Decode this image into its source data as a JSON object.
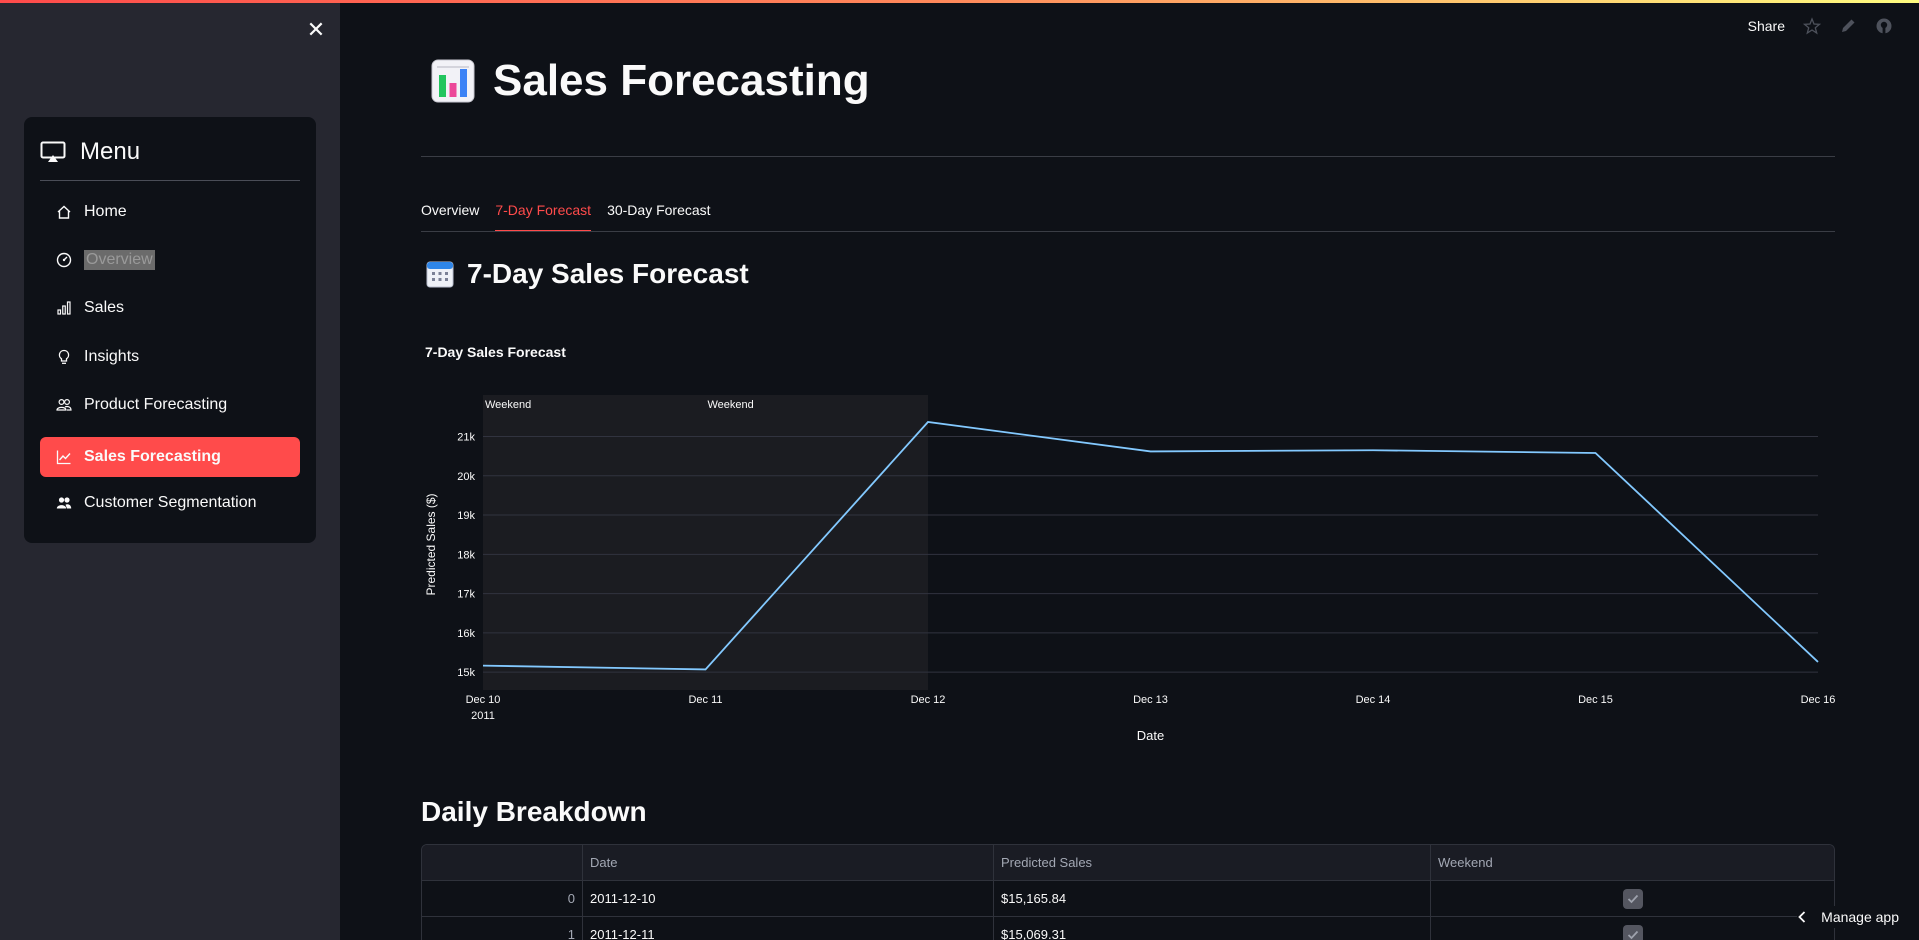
{
  "sidebar": {
    "menu_title": "Menu",
    "items": [
      {
        "label": "Home",
        "icon": "house-icon"
      },
      {
        "label": "Overview",
        "icon": "speedometer-icon"
      },
      {
        "label": "Sales",
        "icon": "bar-chart-icon"
      },
      {
        "label": "Insights",
        "icon": "lightbulb-icon"
      },
      {
        "label": "Product Forecasting",
        "icon": "people-icon"
      },
      {
        "label": "Sales Forecasting",
        "icon": "graph-up-icon"
      },
      {
        "label": "Customer Segmentation",
        "icon": "people-fill-icon"
      }
    ],
    "active_item": "Sales Forecasting",
    "accent_color": "#ff4b4b"
  },
  "toolbar": {
    "share_label": "Share"
  },
  "page": {
    "title": "Sales Forecasting",
    "tabs": [
      "Overview",
      "7-Day Forecast",
      "30-Day Forecast"
    ],
    "active_tab": "7-Day Forecast",
    "subheader": "7-Day Sales Forecast",
    "breakdown_title": "Daily Breakdown"
  },
  "chart_data": {
    "type": "line",
    "title": "7-Day Sales Forecast",
    "xlabel": "Date",
    "ylabel": "Predicted Sales ($)",
    "x": [
      "2011-12-10",
      "2011-12-11",
      "2011-12-12",
      "2011-12-13",
      "2011-12-14",
      "2011-12-15",
      "2011-12-16"
    ],
    "x_tick_labels": [
      "Dec 10",
      "Dec 11",
      "Dec 12",
      "Dec 13",
      "Dec 14",
      "Dec 15",
      "Dec 16"
    ],
    "x_tick_sublabel": "2011",
    "values": [
      15165.84,
      15069.31,
      21370,
      20620,
      20650,
      20580,
      15260
    ],
    "y_ticks": [
      15000,
      16000,
      17000,
      18000,
      19000,
      20000,
      21000
    ],
    "y_tick_labels": [
      "15k",
      "16k",
      "17k",
      "18k",
      "19k",
      "20k",
      "21k"
    ],
    "ylim": [
      14800,
      21700
    ],
    "weekend_bands": [
      {
        "start": "2011-12-10",
        "end": "2011-12-11",
        "label": "Weekend"
      },
      {
        "start": "2011-12-11",
        "end": "2011-12-12",
        "label": "Weekend"
      }
    ],
    "line_color": "#83c9ff",
    "grid": true
  },
  "table": {
    "columns": [
      "",
      "Date",
      "Predicted Sales",
      "Weekend"
    ],
    "rows": [
      {
        "index": "0",
        "date": "2011-12-10",
        "sales": "$15,165.84",
        "weekend": true
      },
      {
        "index": "1",
        "date": "2011-12-11",
        "sales": "$15,069.31",
        "weekend": true
      }
    ]
  },
  "manage_app_label": "Manage app"
}
